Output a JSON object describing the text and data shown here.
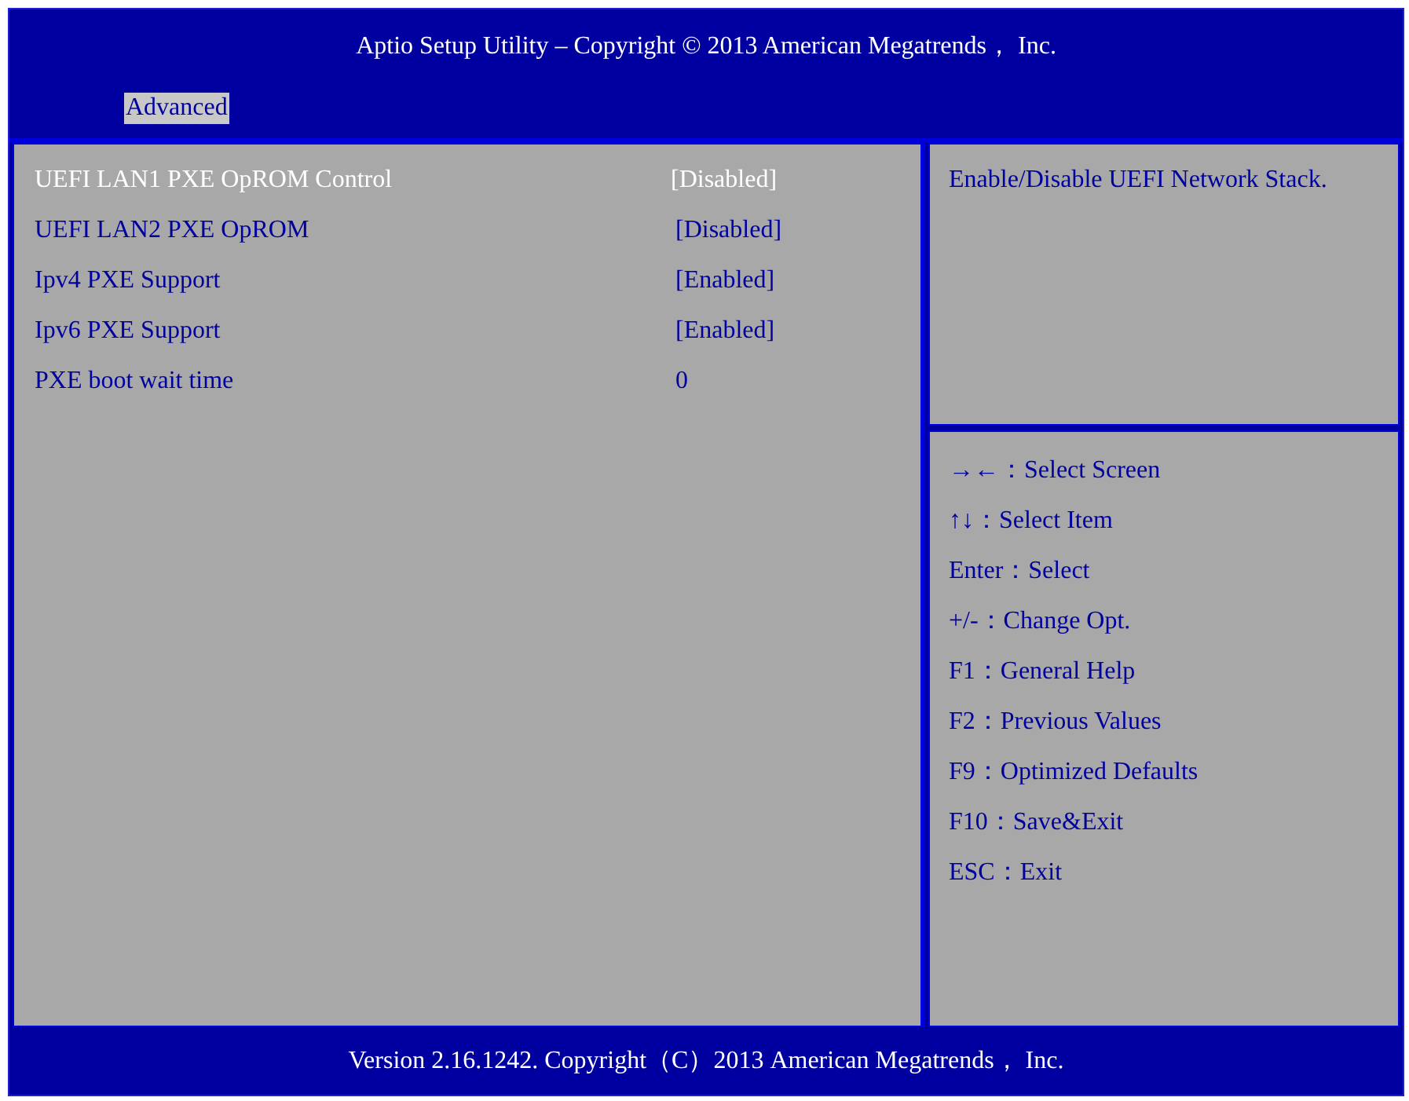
{
  "title": "Aptio Setup Utility – Copyright © 2013 American Megatrends， Inc.",
  "tabs": [
    {
      "label": "Advanced",
      "selected": true
    }
  ],
  "settings": [
    {
      "name": "UEFI LAN1 PXE OpROM Control",
      "value": "[Disabled]",
      "selected": true
    },
    {
      "name": "UEFI LAN2 PXE OpROM",
      "value": "[Disabled]",
      "selected": false
    },
    {
      "name": "Ipv4 PXE Support",
      "value": "[Enabled]",
      "selected": false
    },
    {
      "name": "Ipv6 PXE Support",
      "value": "[Enabled]",
      "selected": false
    },
    {
      "name": "PXE boot wait time",
      "value": "0",
      "selected": false
    }
  ],
  "help_text": "Enable/Disable UEFI Network Stack.",
  "key_help": [
    "→←：Select Screen",
    "↑↓：Select Item",
    "Enter：Select",
    "+/-：Change Opt.",
    "F1：General Help",
    "F2：Previous Values",
    "F9：Optimized Defaults",
    "F10：Save&Exit",
    "ESC：Exit"
  ],
  "footer": "Version 2.16.1242. Copyright（C）2013 American Megatrends， Inc."
}
